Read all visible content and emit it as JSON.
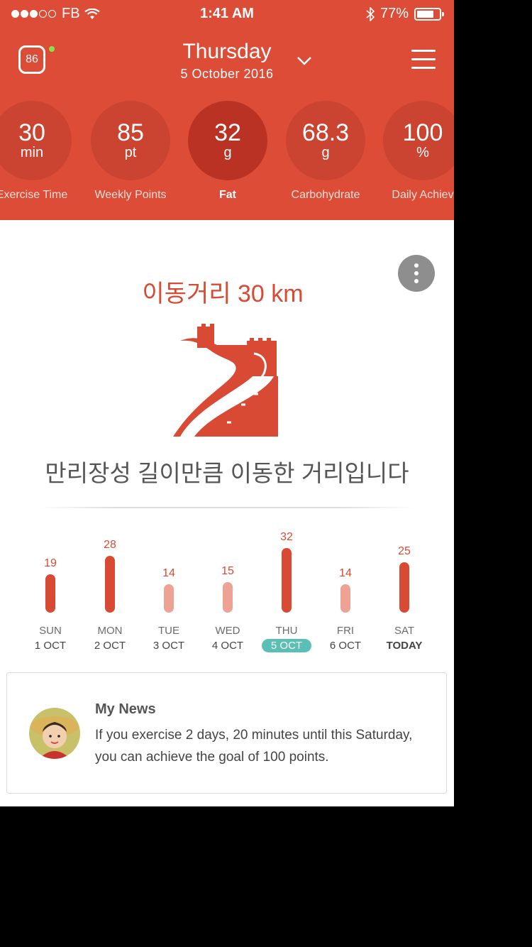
{
  "status_bar": {
    "carrier": "FB",
    "time": "1:41 AM",
    "battery": "77%",
    "battery_level": 0.77
  },
  "header": {
    "badge_value": "86",
    "day": "Thursday",
    "date": "5 October 2016",
    "icons": [
      "chevron-down-icon",
      "hamburger-menu-icon"
    ]
  },
  "stats": [
    {
      "value": "30",
      "unit": "min",
      "label": "Exercise Time"
    },
    {
      "value": "85",
      "unit": "pt",
      "label": "Weekly Points"
    },
    {
      "value": "32",
      "unit": "g",
      "label": "Fat"
    },
    {
      "value": "68.3",
      "unit": "g",
      "label": "Carbohydrate"
    },
    {
      "value": "100",
      "unit": "%",
      "label": "Daily Achiev"
    }
  ],
  "card": {
    "title": "이동거리 30 km",
    "subtitle": "만리장성 길이만큼 이동한 거리입니다",
    "icon": "great-wall-icon"
  },
  "week": [
    {
      "value": 19,
      "day": "SUN",
      "date": "1 OCT"
    },
    {
      "value": 28,
      "day": "MON",
      "date": "2 OCT"
    },
    {
      "value": 14,
      "day": "TUE",
      "date": "3 OCT"
    },
    {
      "value": 15,
      "day": "WED",
      "date": "4 OCT"
    },
    {
      "value": 32,
      "day": "THU",
      "date": "5 OCT"
    },
    {
      "value": 14,
      "day": "FRI",
      "date": "6 OCT"
    },
    {
      "value": 25,
      "day": "SAT",
      "date": "TODAY"
    }
  ],
  "news": {
    "title": "My News",
    "body": "If you exercise 2 days, 20 minutes until this Saturday, you can achieve the goal of 100 points."
  },
  "colors": {
    "accent": "#dd4c36",
    "bar_dark": "#d84a33",
    "bar_light": "#eea293",
    "selected": "#5bbfb5"
  }
}
